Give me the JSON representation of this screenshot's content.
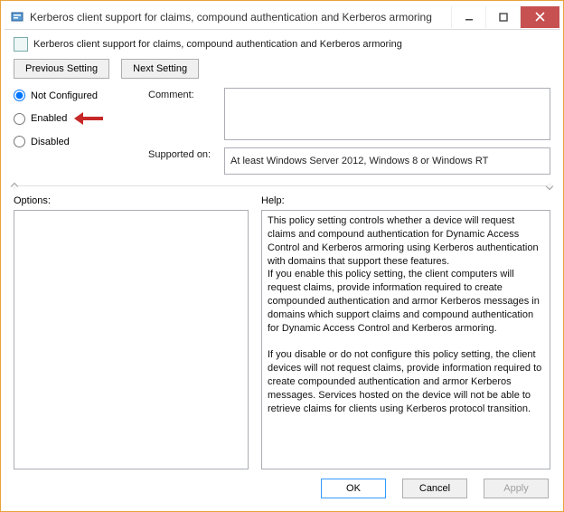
{
  "window": {
    "title": "Kerberos client support for claims, compound authentication and Kerberos armoring",
    "minimize_label": "Minimize",
    "maximize_label": "Maximize",
    "close_label": "Close"
  },
  "header": {
    "policy_title": "Kerberos client support for claims, compound authentication and Kerberos armoring"
  },
  "nav": {
    "previous": "Previous Setting",
    "next": "Next Setting"
  },
  "state": {
    "radio_labels": {
      "not_configured": "Not Configured",
      "enabled": "Enabled",
      "disabled": "Disabled"
    },
    "selected": "not_configured"
  },
  "labels": {
    "comment": "Comment:",
    "supported_on": "Supported on:",
    "options": "Options:",
    "help": "Help:"
  },
  "fields": {
    "comment": "",
    "supported_on": "At least Windows Server 2012, Windows 8 or Windows RT"
  },
  "options_text": "",
  "help_text": "This policy setting controls whether a device will request claims and compound authentication for Dynamic Access Control and Kerberos armoring using Kerberos authentication with domains that support these features.\nIf you enable this policy setting, the client computers will request claims, provide information required to create compounded authentication and armor Kerberos messages in domains which support claims and compound authentication for Dynamic Access Control and Kerberos armoring.\n\nIf you disable or do not configure this policy setting, the client devices will not request claims, provide information required to create compounded authentication and armor Kerberos messages. Services hosted on the device will not be able to retrieve claims for clients using Kerberos protocol transition.",
  "buttons": {
    "ok": "OK",
    "cancel": "Cancel",
    "apply": "Apply"
  },
  "annotation": {
    "arrow_color": "#c62828"
  }
}
